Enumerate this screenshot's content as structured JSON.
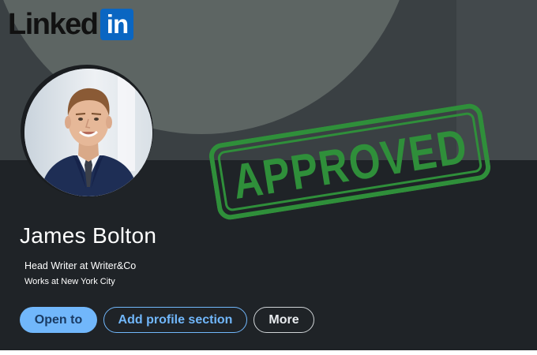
{
  "logo": {
    "word": "Linked",
    "box": "in",
    "brand_color": "#0a66c2"
  },
  "stamp": {
    "text": "APPROVED",
    "color": "#2f8f3a"
  },
  "profile": {
    "name": "James Bolton",
    "headline": "Head Writer at Writer&Co",
    "location": "Works at New York City"
  },
  "actions": {
    "open_to": "Open to",
    "add_profile_section": "Add profile section",
    "more": "More"
  },
  "colors": {
    "accent": "#71b7fb",
    "card_background": "#1f2327",
    "banner_background": "#3a4043"
  },
  "icons": [
    "linkedin-logo-icon",
    "approved-stamp-icon",
    "avatar"
  ]
}
